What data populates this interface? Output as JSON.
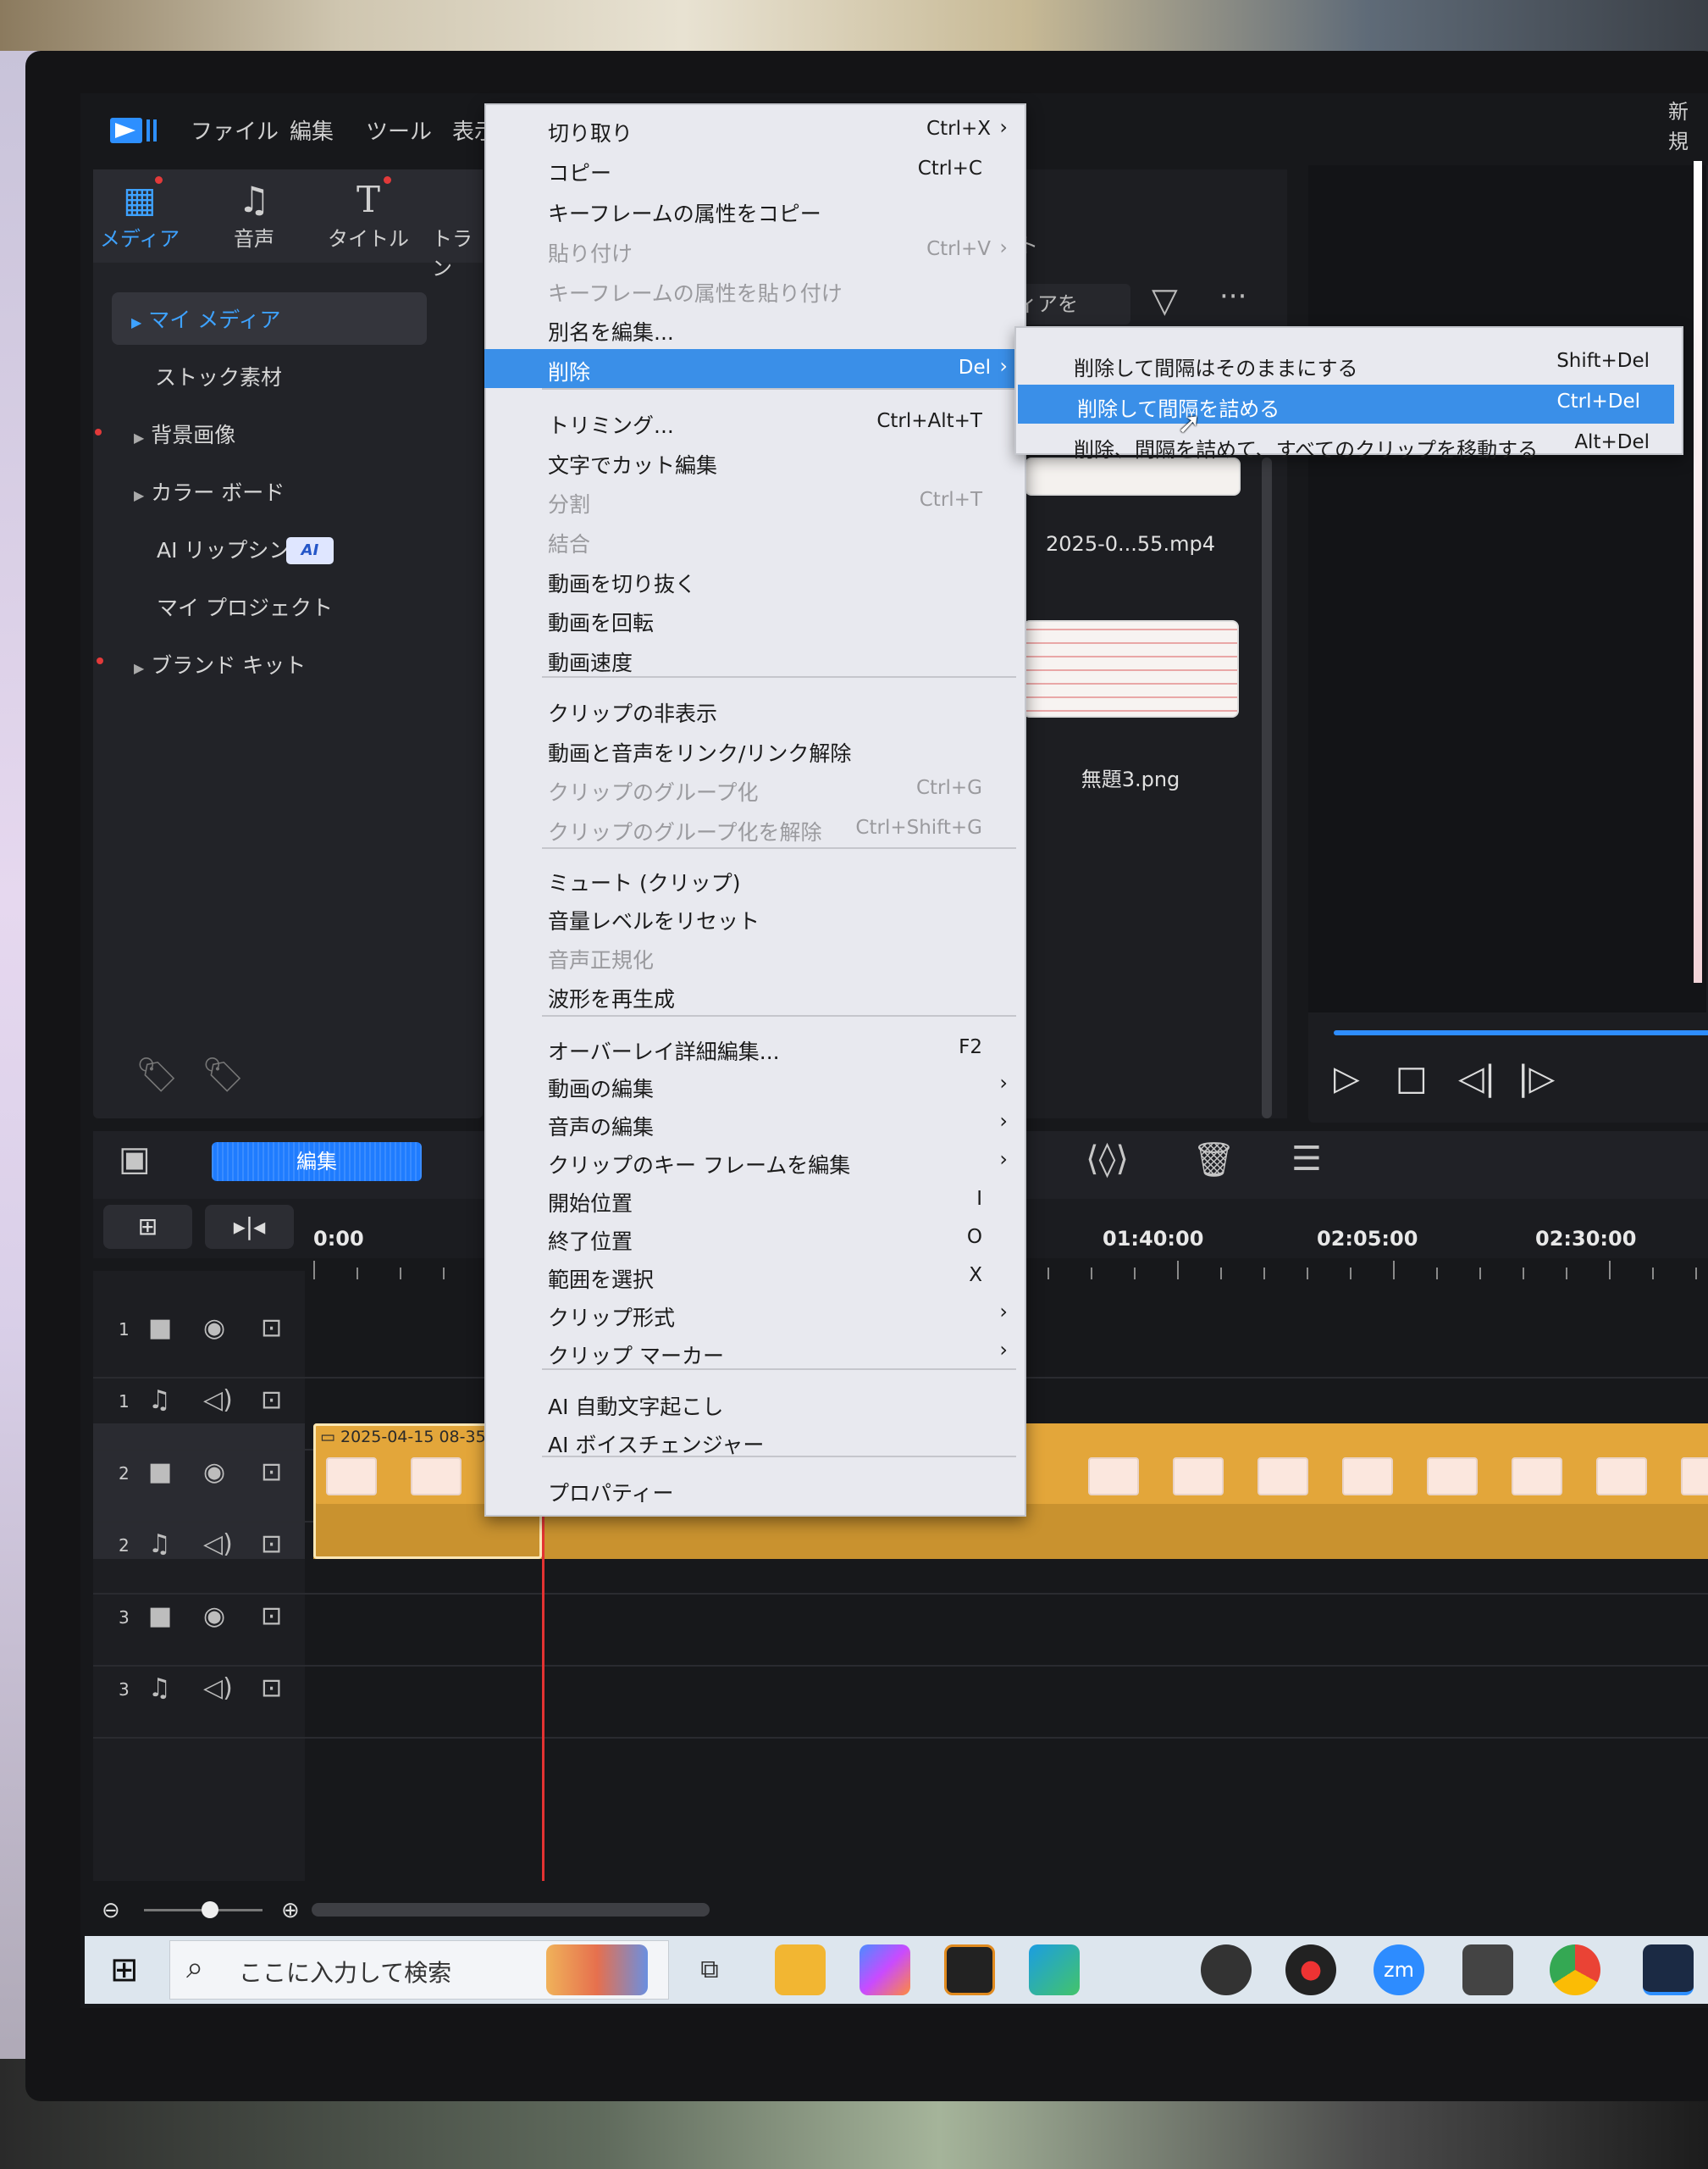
{
  "menubar": {
    "items": [
      "ファイル",
      "編集",
      "ツール",
      "表示"
    ],
    "right_text": "新規"
  },
  "media_tabs": [
    {
      "label": "メディア",
      "icon": "media-icon",
      "glyph": "▦"
    },
    {
      "label": "音声",
      "icon": "music-note-icon",
      "glyph": "♫"
    },
    {
      "label": "タイトル",
      "icon": "text-t-icon",
      "glyph": "T"
    },
    {
      "label": "トラン",
      "icon": "transition-icon",
      "glyph": ""
    }
  ],
  "left_nav": {
    "items": [
      "マイ メディア",
      "ストック素材",
      "背景画像",
      "カラー ボード",
      "AI リップシンク",
      "マイ プロジェクト",
      "ブランド キット"
    ],
    "ai_badge": "AI"
  },
  "media_panel": {
    "tab_fragment": "ト",
    "search_fragment": "ィアを",
    "item1_label": "2025-0...55.mp4",
    "item2_label": "無題3.png"
  },
  "context_menu": {
    "items": [
      {
        "label": "切り取り",
        "shortcut": "Ctrl+X",
        "arrow": "›",
        "disabled": false
      },
      {
        "label": "コピー",
        "shortcut": "Ctrl+C",
        "disabled": false
      },
      {
        "label": "キーフレームの属性をコピー",
        "shortcut": "",
        "disabled": false
      },
      {
        "label": "貼り付け",
        "shortcut": "Ctrl+V",
        "arrow": "›",
        "disabled": true
      },
      {
        "label": "キーフレームの属性を貼り付け",
        "shortcut": "",
        "disabled": true
      },
      {
        "label": "別名を編集...",
        "shortcut": "",
        "disabled": false
      },
      {
        "label": "削除",
        "shortcut": "Del",
        "arrow": "›",
        "disabled": false,
        "selected": true
      },
      {
        "label": "トリミング...",
        "shortcut": "Ctrl+Alt+T",
        "disabled": false
      },
      {
        "label": "文字でカット編集",
        "shortcut": "",
        "disabled": false
      },
      {
        "label": "分割",
        "shortcut": "Ctrl+T",
        "disabled": true
      },
      {
        "label": "結合",
        "shortcut": "",
        "disabled": true
      },
      {
        "label": "動画を切り抜く",
        "shortcut": "",
        "disabled": false
      },
      {
        "label": "動画を回転",
        "shortcut": "",
        "disabled": false
      },
      {
        "label": "動画速度",
        "shortcut": "",
        "disabled": false
      },
      {
        "label": "クリップの非表示",
        "shortcut": "",
        "disabled": false
      },
      {
        "label": "動画と音声をリンク/リンク解除",
        "shortcut": "",
        "disabled": false
      },
      {
        "label": "クリップのグループ化",
        "shortcut": "Ctrl+G",
        "disabled": true
      },
      {
        "label": "クリップのグループ化を解除",
        "shortcut": "Ctrl+Shift+G",
        "disabled": true
      },
      {
        "label": "ミュート (クリップ)",
        "shortcut": "",
        "disabled": false
      },
      {
        "label": "音量レベルをリセット",
        "shortcut": "",
        "disabled": false
      },
      {
        "label": "音声正規化",
        "shortcut": "",
        "disabled": true
      },
      {
        "label": "波形を再生成",
        "shortcut": "",
        "disabled": false
      },
      {
        "label": "オーバーレイ詳細編集...",
        "shortcut": "F2",
        "disabled": false
      },
      {
        "label": "動画の編集",
        "shortcut": "",
        "arrow": "›",
        "disabled": false
      },
      {
        "label": "音声の編集",
        "shortcut": "",
        "arrow": "›",
        "disabled": false
      },
      {
        "label": "クリップのキー フレームを編集",
        "shortcut": "",
        "arrow": "›",
        "disabled": false
      },
      {
        "label": "開始位置",
        "shortcut": "I",
        "disabled": false
      },
      {
        "label": "終了位置",
        "shortcut": "O",
        "disabled": false
      },
      {
        "label": "範囲を選択",
        "shortcut": "X",
        "disabled": false
      },
      {
        "label": "クリップ形式",
        "shortcut": "",
        "arrow": "›",
        "disabled": false
      },
      {
        "label": "クリップ マーカー",
        "shortcut": "",
        "arrow": "›",
        "disabled": false
      },
      {
        "label": "AI 自動文字起こし",
        "shortcut": "",
        "disabled": false
      },
      {
        "label": "AI ボイスチェンジャー",
        "shortcut": "",
        "disabled": false
      },
      {
        "label": "プロパティー",
        "shortcut": "",
        "disabled": false
      }
    ]
  },
  "delete_submenu": {
    "items": [
      {
        "label": "削除して間隔はそのままにする",
        "shortcut": "Shift+Del"
      },
      {
        "label": "削除して間隔を詰める",
        "shortcut": "Ctrl+Del",
        "selected": true
      },
      {
        "label": "削除、間隔を詰めて、すべてのクリップを移動する",
        "shortcut": "Alt+Del"
      }
    ]
  },
  "timeline": {
    "edit_button": "編集",
    "ruler_labels": [
      "0:00",
      "01:40:00",
      "02:05:00",
      "02:30:00"
    ],
    "clip_title": "2025-04-15 08-35",
    "tracks": [
      {
        "num": "1",
        "type": "video"
      },
      {
        "num": "1",
        "type": "audio"
      },
      {
        "num": "2",
        "type": "video"
      },
      {
        "num": "2",
        "type": "audio"
      },
      {
        "num": "3",
        "type": "video"
      },
      {
        "num": "3",
        "type": "audio"
      }
    ]
  },
  "taskbar": {
    "search_placeholder": "ここに入力して検索",
    "zoom_app_label": "zm"
  },
  "colors": {
    "accent": "#3a8fe8",
    "clip": "#e3a63a",
    "playhead": "#e33232",
    "active_tab": "#3ea2ff"
  }
}
